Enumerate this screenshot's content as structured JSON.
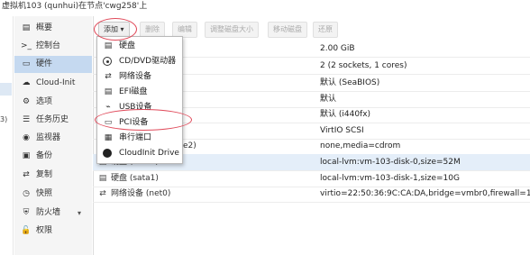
{
  "window": {
    "title": "虚拟机103 (qunhui)在节点'cwg258'上"
  },
  "left_fragment": "3)",
  "nav": {
    "items": [
      {
        "icon": "book-icon",
        "glyph": "▤",
        "label": "概要",
        "active": false
      },
      {
        "icon": "terminal-icon",
        "glyph": ">_",
        "label": "控制台",
        "active": false
      },
      {
        "icon": "monitor-icon",
        "glyph": "▭",
        "label": "硬件",
        "active": true
      },
      {
        "icon": "cloud-icon",
        "glyph": "☁",
        "label": "Cloud-Init",
        "active": false
      },
      {
        "icon": "gear-icon",
        "glyph": "⚙",
        "label": "选项",
        "active": false
      },
      {
        "icon": "list-icon",
        "glyph": "☰",
        "label": "任务历史",
        "active": false
      },
      {
        "icon": "eye-icon",
        "glyph": "◉",
        "label": "监视器",
        "active": false
      },
      {
        "icon": "save-icon",
        "glyph": "▣",
        "label": "备份",
        "active": false
      },
      {
        "icon": "retweet-icon",
        "glyph": "⇄",
        "label": "复制",
        "active": false
      },
      {
        "icon": "history-icon",
        "glyph": "◷",
        "label": "快照",
        "active": false
      },
      {
        "icon": "shield-icon",
        "glyph": "⛨",
        "label": "防火墙",
        "active": false
      },
      {
        "icon": "unlock-icon",
        "glyph": "🔓",
        "label": "权限",
        "active": false
      }
    ]
  },
  "toolbar": {
    "add_label": "添加",
    "remove_label": "删除",
    "edit_label": "编辑",
    "resize_label": "调整磁盘大小",
    "move_label": "移动磁盘",
    "revert_label": "还原"
  },
  "hardware": {
    "rows": [
      {
        "icon": "",
        "key": "",
        "value": "2.00 GiB"
      },
      {
        "icon": "",
        "key": "",
        "value": "2 (2 sockets, 1 cores)"
      },
      {
        "icon": "",
        "key": "",
        "value": "默认 (SeaBIOS)"
      },
      {
        "icon": "",
        "key": "",
        "value": "默认"
      },
      {
        "icon": "",
        "key": "",
        "value": "默认 (i440fx)"
      },
      {
        "icon": "",
        "key": "",
        "value": "VirtIO SCSI"
      },
      {
        "icon": "",
        "key": "e2)",
        "value": "none,media=cdrom"
      },
      {
        "icon": "▤",
        "key": "硬盘 (sata0)",
        "value": "local-lvm:vm-103-disk-0,size=52M"
      },
      {
        "icon": "▤",
        "key": "硬盘 (sata1)",
        "value": "local-lvm:vm-103-disk-1,size=10G"
      },
      {
        "icon": "⇄",
        "key": "网络设备 (net0)",
        "value": "virtio=22:50:36:9C:CA:DA,bridge=vmbr0,firewall=1"
      }
    ]
  },
  "add_menu": {
    "items": [
      {
        "icon": "hdd-icon",
        "glyph": "▤",
        "label": "硬盘"
      },
      {
        "icon": "cdrom-icon",
        "glyph": "",
        "label": "CD/DVD驱动器"
      },
      {
        "icon": "network-icon",
        "glyph": "⇄",
        "label": "网络设备"
      },
      {
        "icon": "efi-disk-icon",
        "glyph": "▤",
        "label": "EFI磁盘"
      },
      {
        "icon": "usb-icon",
        "glyph": "⌁",
        "label": "USB设备"
      },
      {
        "icon": "pci-card-icon",
        "glyph": "▭",
        "label": "PCI设备"
      },
      {
        "icon": "serial-port-icon",
        "glyph": "▦",
        "label": "串行端口"
      },
      {
        "icon": "cloudinit-icon",
        "glyph": "",
        "label": "CloudInit Drive"
      }
    ]
  },
  "colors": {
    "annotation": "#e04a5a",
    "nav_active": "#c5d9f0"
  }
}
